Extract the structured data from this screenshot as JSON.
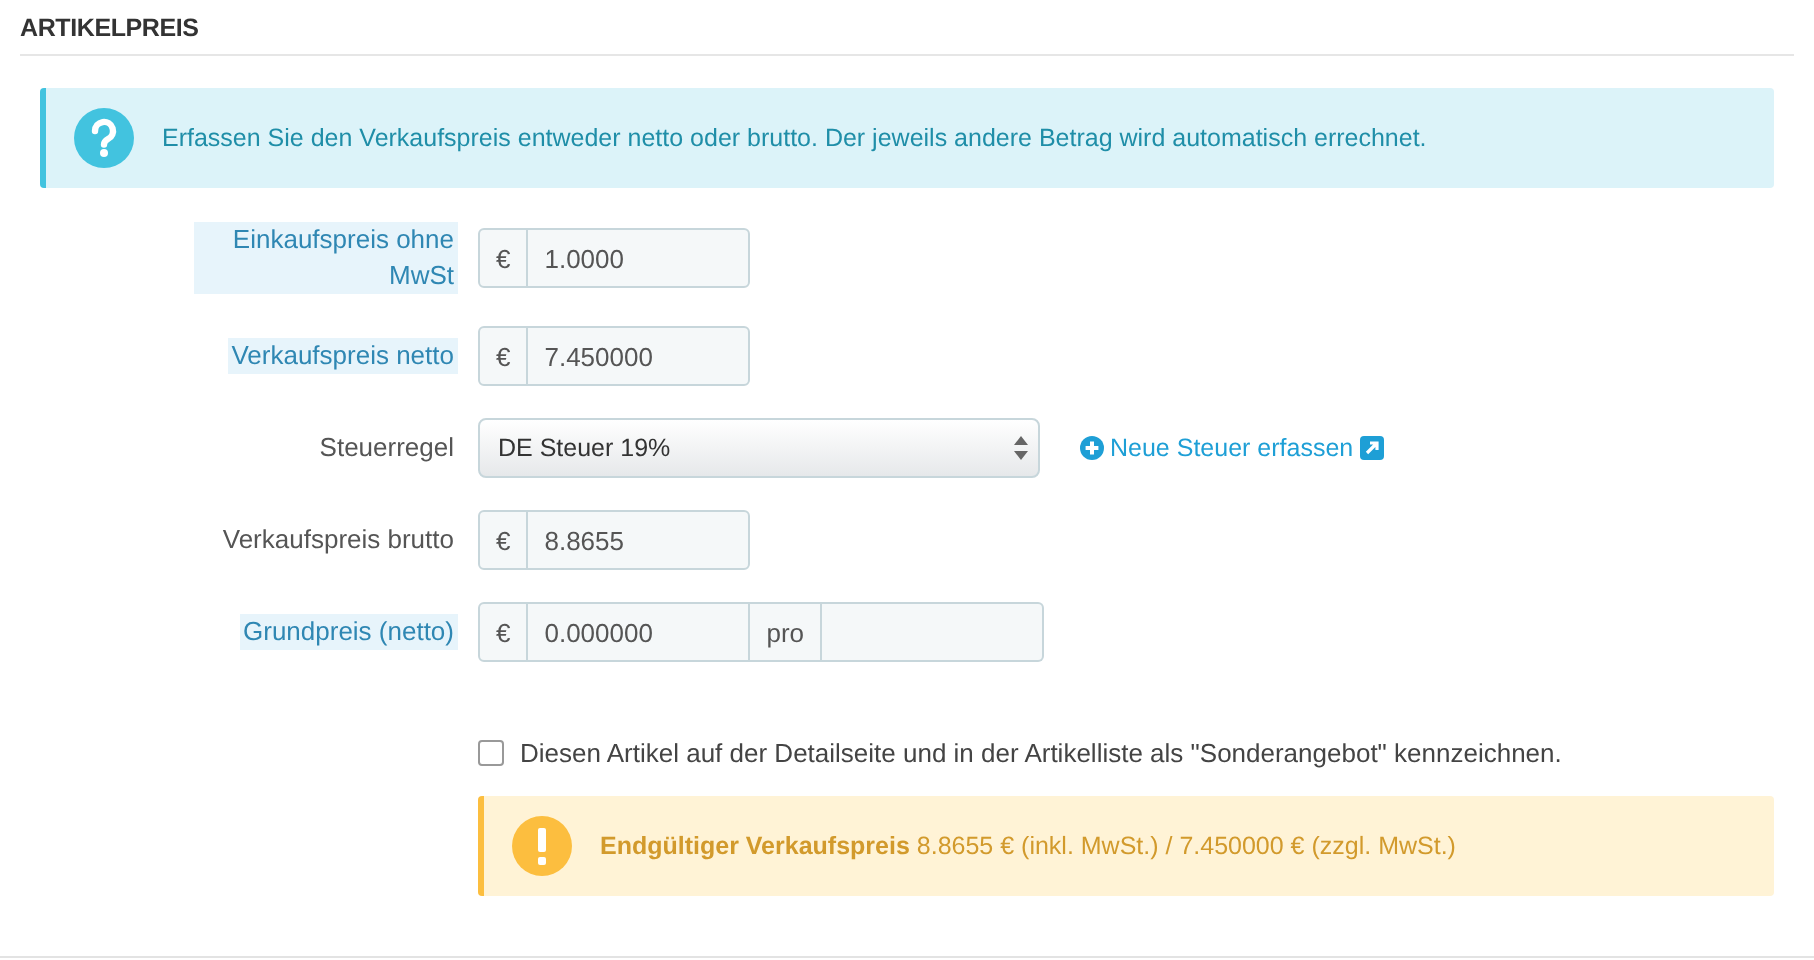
{
  "panel": {
    "title": "ARTIKELPREIS"
  },
  "info": {
    "text": "Erfassen Sie den Verkaufspreis entweder netto oder brutto. Der jeweils andere Betrag wird automatisch errechnet."
  },
  "rows": [
    {
      "kind": "money",
      "label": "Einkaufspreis ohne MwSt",
      "help": true,
      "currency": "€",
      "value": "1.0000"
    },
    {
      "kind": "money",
      "label": "Verkaufspreis netto",
      "help": true,
      "currency": "€",
      "value": "7.450000"
    },
    {
      "kind": "select",
      "label": "Steuerregel",
      "help": false,
      "value": "DE Steuer 19%",
      "link": "Neue Steuer erfassen"
    },
    {
      "kind": "money",
      "label": "Verkaufspreis brutto",
      "help": false,
      "currency": "€",
      "value": "8.8655"
    },
    {
      "kind": "unit",
      "label": "Grundpreis (netto)",
      "help": true,
      "currency": "€",
      "value": "0.000000",
      "unit_label": "pro"
    }
  ],
  "special_offer": {
    "label": "Diesen Artikel auf der Detailseite und in der Artikelliste als \"Sonderangebot\" kennzeichnen.",
    "checked": false
  },
  "warning": {
    "text": "**Endgültiger Verkaufspreis** 8.8655 € (inkl. MwSt.) / 7.450000 € (zzgl. MwSt.)"
  }
}
